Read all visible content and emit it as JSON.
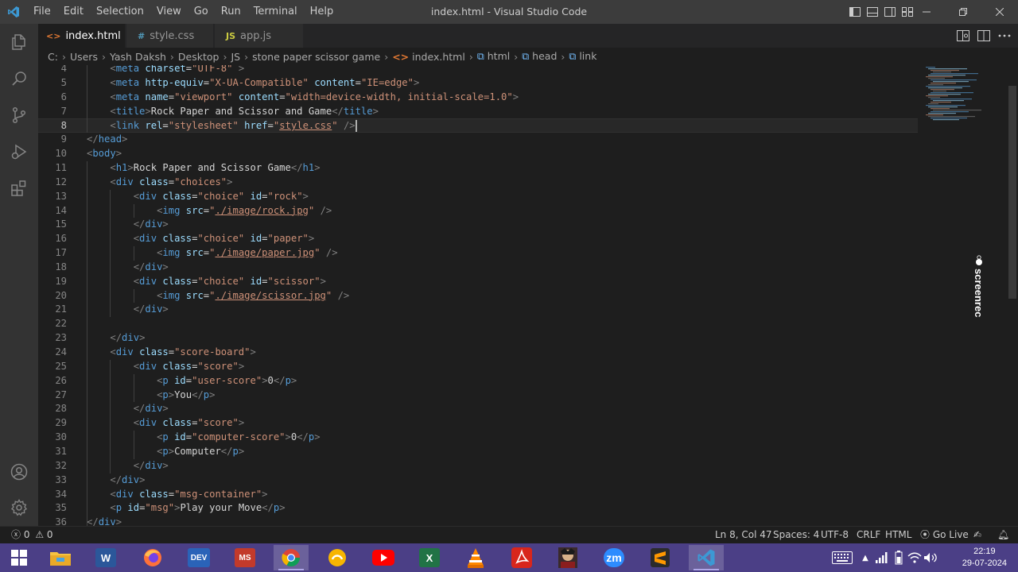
{
  "window": {
    "title": "index.html - Visual Studio Code"
  },
  "menu": [
    "File",
    "Edit",
    "Selection",
    "View",
    "Go",
    "Run",
    "Terminal",
    "Help"
  ],
  "tabs": [
    {
      "label": "index.html",
      "icon": "html-file-icon",
      "icon_glyph": "<>",
      "icon_color": "#e37933",
      "active": true
    },
    {
      "label": "style.css",
      "icon": "css-file-icon",
      "icon_glyph": "#",
      "icon_color": "#519aba",
      "active": false
    },
    {
      "label": "app.js",
      "icon": "js-file-icon",
      "icon_glyph": "JS",
      "icon_color": "#cbcb41",
      "active": false
    }
  ],
  "breadcrumb": [
    "C:",
    "Users",
    "Yash Daksh",
    "Desktop",
    "JS",
    "stone paper scissor game",
    "index.html",
    "html",
    "head",
    "link"
  ],
  "editor": {
    "current_line": 8,
    "lines": [
      {
        "n": "4",
        "indent": 2,
        "segs": [
          [
            "tg",
            "<"
          ],
          [
            "tn",
            "meta"
          ],
          [
            "tx",
            " "
          ],
          [
            "an",
            "charset"
          ],
          [
            "tx",
            "="
          ],
          [
            "av",
            "\"UTF-8\""
          ],
          [
            "tx",
            " "
          ],
          [
            "tg",
            ">"
          ]
        ]
      },
      {
        "n": "5",
        "indent": 2,
        "segs": [
          [
            "tg",
            "<"
          ],
          [
            "tn",
            "meta"
          ],
          [
            "tx",
            " "
          ],
          [
            "an",
            "http-equiv"
          ],
          [
            "tx",
            "="
          ],
          [
            "av",
            "\"X-UA-Compatible\""
          ],
          [
            "tx",
            " "
          ],
          [
            "an",
            "content"
          ],
          [
            "tx",
            "="
          ],
          [
            "av",
            "\"IE=edge\""
          ],
          [
            "tg",
            ">"
          ]
        ]
      },
      {
        "n": "6",
        "indent": 2,
        "segs": [
          [
            "tg",
            "<"
          ],
          [
            "tn",
            "meta"
          ],
          [
            "tx",
            " "
          ],
          [
            "an",
            "name"
          ],
          [
            "tx",
            "="
          ],
          [
            "av",
            "\"viewport\""
          ],
          [
            "tx",
            " "
          ],
          [
            "an",
            "content"
          ],
          [
            "tx",
            "="
          ],
          [
            "av",
            "\"width=device-width, initial-scale=1.0\""
          ],
          [
            "tg",
            ">"
          ]
        ]
      },
      {
        "n": "7",
        "indent": 2,
        "segs": [
          [
            "tg",
            "<"
          ],
          [
            "tn",
            "title"
          ],
          [
            "tg",
            ">"
          ],
          [
            "tx",
            "Rock Paper and Scissor and Game"
          ],
          [
            "tg",
            "</"
          ],
          [
            "tn",
            "title"
          ],
          [
            "tg",
            ">"
          ]
        ]
      },
      {
        "n": "8",
        "indent": 2,
        "segs": [
          [
            "tg",
            "<"
          ],
          [
            "tn",
            "link"
          ],
          [
            "tx",
            " "
          ],
          [
            "an",
            "rel"
          ],
          [
            "tx",
            "="
          ],
          [
            "av",
            "\"stylesheet\""
          ],
          [
            "tx",
            " "
          ],
          [
            "an",
            "href"
          ],
          [
            "tx",
            "="
          ],
          [
            "av",
            "\""
          ],
          [
            "avu",
            "style.css"
          ],
          [
            "av",
            "\""
          ],
          [
            "tx",
            " "
          ],
          [
            "tg",
            "/>"
          ]
        ],
        "cursor": true
      },
      {
        "n": "9",
        "indent": 0,
        "segs": [
          [
            "tg",
            "</"
          ],
          [
            "tn",
            "head"
          ],
          [
            "tg",
            ">"
          ]
        ]
      },
      {
        "n": "10",
        "indent": 0,
        "segs": [
          [
            "tg",
            "<"
          ],
          [
            "tn",
            "body"
          ],
          [
            "tg",
            ">"
          ]
        ]
      },
      {
        "n": "11",
        "indent": 2,
        "segs": [
          [
            "tg",
            "<"
          ],
          [
            "tn",
            "h1"
          ],
          [
            "tg",
            ">"
          ],
          [
            "tx",
            "Rock Paper and Scissor Game"
          ],
          [
            "tg",
            "</"
          ],
          [
            "tn",
            "h1"
          ],
          [
            "tg",
            ">"
          ]
        ]
      },
      {
        "n": "12",
        "indent": 2,
        "segs": [
          [
            "tg",
            "<"
          ],
          [
            "tn",
            "div"
          ],
          [
            "tx",
            " "
          ],
          [
            "an",
            "class"
          ],
          [
            "tx",
            "="
          ],
          [
            "av",
            "\"choices\""
          ],
          [
            "tg",
            ">"
          ]
        ]
      },
      {
        "n": "13",
        "indent": 4,
        "segs": [
          [
            "tg",
            "<"
          ],
          [
            "tn",
            "div"
          ],
          [
            "tx",
            " "
          ],
          [
            "an",
            "class"
          ],
          [
            "tx",
            "="
          ],
          [
            "av",
            "\"choice\""
          ],
          [
            "tx",
            " "
          ],
          [
            "an",
            "id"
          ],
          [
            "tx",
            "="
          ],
          [
            "av",
            "\"rock\""
          ],
          [
            "tg",
            ">"
          ]
        ]
      },
      {
        "n": "14",
        "indent": 6,
        "segs": [
          [
            "tg",
            "<"
          ],
          [
            "tn",
            "img"
          ],
          [
            "tx",
            " "
          ],
          [
            "an",
            "src"
          ],
          [
            "tx",
            "="
          ],
          [
            "av",
            "\""
          ],
          [
            "avu",
            "./image/rock.jpg"
          ],
          [
            "av",
            "\""
          ],
          [
            "tx",
            " "
          ],
          [
            "tg",
            "/>"
          ]
        ]
      },
      {
        "n": "15",
        "indent": 4,
        "segs": [
          [
            "tg",
            "</"
          ],
          [
            "tn",
            "div"
          ],
          [
            "tg",
            ">"
          ]
        ]
      },
      {
        "n": "16",
        "indent": 4,
        "segs": [
          [
            "tg",
            "<"
          ],
          [
            "tn",
            "div"
          ],
          [
            "tx",
            " "
          ],
          [
            "an",
            "class"
          ],
          [
            "tx",
            "="
          ],
          [
            "av",
            "\"choice\""
          ],
          [
            "tx",
            " "
          ],
          [
            "an",
            "id"
          ],
          [
            "tx",
            "="
          ],
          [
            "av",
            "\"paper\""
          ],
          [
            "tg",
            ">"
          ]
        ]
      },
      {
        "n": "17",
        "indent": 6,
        "segs": [
          [
            "tg",
            "<"
          ],
          [
            "tn",
            "img"
          ],
          [
            "tx",
            " "
          ],
          [
            "an",
            "src"
          ],
          [
            "tx",
            "="
          ],
          [
            "av",
            "\""
          ],
          [
            "avu",
            "./image/paper.jpg"
          ],
          [
            "av",
            "\""
          ],
          [
            "tx",
            " "
          ],
          [
            "tg",
            "/>"
          ]
        ]
      },
      {
        "n": "18",
        "indent": 4,
        "segs": [
          [
            "tg",
            "</"
          ],
          [
            "tn",
            "div"
          ],
          [
            "tg",
            ">"
          ]
        ]
      },
      {
        "n": "19",
        "indent": 4,
        "segs": [
          [
            "tg",
            "<"
          ],
          [
            "tn",
            "div"
          ],
          [
            "tx",
            " "
          ],
          [
            "an",
            "class"
          ],
          [
            "tx",
            "="
          ],
          [
            "av",
            "\"choice\""
          ],
          [
            "tx",
            " "
          ],
          [
            "an",
            "id"
          ],
          [
            "tx",
            "="
          ],
          [
            "av",
            "\"scissor\""
          ],
          [
            "tg",
            ">"
          ]
        ]
      },
      {
        "n": "20",
        "indent": 6,
        "segs": [
          [
            "tg",
            "<"
          ],
          [
            "tn",
            "img"
          ],
          [
            "tx",
            " "
          ],
          [
            "an",
            "src"
          ],
          [
            "tx",
            "="
          ],
          [
            "av",
            "\""
          ],
          [
            "avu",
            "./image/scissor.jpg"
          ],
          [
            "av",
            "\""
          ],
          [
            "tx",
            " "
          ],
          [
            "tg",
            "/>"
          ]
        ]
      },
      {
        "n": "21",
        "indent": 4,
        "segs": [
          [
            "tg",
            "</"
          ],
          [
            "tn",
            "div"
          ],
          [
            "tg",
            ">"
          ]
        ]
      },
      {
        "n": "22",
        "indent": 0,
        "segs": []
      },
      {
        "n": "23",
        "indent": 2,
        "segs": [
          [
            "tg",
            "</"
          ],
          [
            "tn",
            "div"
          ],
          [
            "tg",
            ">"
          ]
        ]
      },
      {
        "n": "24",
        "indent": 2,
        "segs": [
          [
            "tg",
            "<"
          ],
          [
            "tn",
            "div"
          ],
          [
            "tx",
            " "
          ],
          [
            "an",
            "class"
          ],
          [
            "tx",
            "="
          ],
          [
            "av",
            "\"score-board\""
          ],
          [
            "tg",
            ">"
          ]
        ]
      },
      {
        "n": "25",
        "indent": 4,
        "segs": [
          [
            "tg",
            "<"
          ],
          [
            "tn",
            "div"
          ],
          [
            "tx",
            " "
          ],
          [
            "an",
            "class"
          ],
          [
            "tx",
            "="
          ],
          [
            "av",
            "\"score\""
          ],
          [
            "tg",
            ">"
          ]
        ]
      },
      {
        "n": "26",
        "indent": 6,
        "segs": [
          [
            "tg",
            "<"
          ],
          [
            "tn",
            "p"
          ],
          [
            "tx",
            " "
          ],
          [
            "an",
            "id"
          ],
          [
            "tx",
            "="
          ],
          [
            "av",
            "\"user-score\""
          ],
          [
            "tg",
            ">"
          ],
          [
            "tx",
            "0"
          ],
          [
            "tg",
            "</"
          ],
          [
            "tn",
            "p"
          ],
          [
            "tg",
            ">"
          ]
        ]
      },
      {
        "n": "27",
        "indent": 6,
        "segs": [
          [
            "tg",
            "<"
          ],
          [
            "tn",
            "p"
          ],
          [
            "tg",
            ">"
          ],
          [
            "tx",
            "You"
          ],
          [
            "tg",
            "</"
          ],
          [
            "tn",
            "p"
          ],
          [
            "tg",
            ">"
          ]
        ]
      },
      {
        "n": "28",
        "indent": 4,
        "segs": [
          [
            "tg",
            "</"
          ],
          [
            "tn",
            "div"
          ],
          [
            "tg",
            ">"
          ]
        ]
      },
      {
        "n": "29",
        "indent": 4,
        "segs": [
          [
            "tg",
            "<"
          ],
          [
            "tn",
            "div"
          ],
          [
            "tx",
            " "
          ],
          [
            "an",
            "class"
          ],
          [
            "tx",
            "="
          ],
          [
            "av",
            "\"score\""
          ],
          [
            "tg",
            ">"
          ]
        ]
      },
      {
        "n": "30",
        "indent": 6,
        "segs": [
          [
            "tg",
            "<"
          ],
          [
            "tn",
            "p"
          ],
          [
            "tx",
            " "
          ],
          [
            "an",
            "id"
          ],
          [
            "tx",
            "="
          ],
          [
            "av",
            "\"computer-score\""
          ],
          [
            "tg",
            ">"
          ],
          [
            "tx",
            "0"
          ],
          [
            "tg",
            "</"
          ],
          [
            "tn",
            "p"
          ],
          [
            "tg",
            ">"
          ]
        ]
      },
      {
        "n": "31",
        "indent": 6,
        "segs": [
          [
            "tg",
            "<"
          ],
          [
            "tn",
            "p"
          ],
          [
            "tg",
            ">"
          ],
          [
            "tx",
            "Computer"
          ],
          [
            "tg",
            "</"
          ],
          [
            "tn",
            "p"
          ],
          [
            "tg",
            ">"
          ]
        ]
      },
      {
        "n": "32",
        "indent": 4,
        "segs": [
          [
            "tg",
            "</"
          ],
          [
            "tn",
            "div"
          ],
          [
            "tg",
            ">"
          ]
        ]
      },
      {
        "n": "33",
        "indent": 2,
        "segs": [
          [
            "tg",
            "</"
          ],
          [
            "tn",
            "div"
          ],
          [
            "tg",
            ">"
          ]
        ]
      },
      {
        "n": "34",
        "indent": 2,
        "segs": [
          [
            "tg",
            "<"
          ],
          [
            "tn",
            "div"
          ],
          [
            "tx",
            " "
          ],
          [
            "an",
            "class"
          ],
          [
            "tx",
            "="
          ],
          [
            "av",
            "\"msg-container\""
          ],
          [
            "tg",
            ">"
          ]
        ]
      },
      {
        "n": "35",
        "indent": 2,
        "segs": [
          [
            "tg",
            "<"
          ],
          [
            "tn",
            "p"
          ],
          [
            "tx",
            " "
          ],
          [
            "an",
            "id"
          ],
          [
            "tx",
            "="
          ],
          [
            "av",
            "\"msg\""
          ],
          [
            "tg",
            ">"
          ],
          [
            "tx",
            "Play your Move"
          ],
          [
            "tg",
            "</"
          ],
          [
            "tn",
            "p"
          ],
          [
            "tg",
            ">"
          ]
        ]
      },
      {
        "n": "36",
        "indent": 0,
        "segs": [
          [
            "tg",
            "</"
          ],
          [
            "tn",
            "div"
          ],
          [
            "tg",
            ">"
          ]
        ]
      }
    ]
  },
  "watermark": {
    "text": "screenrec"
  },
  "statusbar": {
    "errors": "0",
    "warnings": "0",
    "position": "Ln 8, Col 47",
    "spaces": "Spaces: 4",
    "encoding": "UTF-8",
    "eol": "CRLF",
    "language": "HTML",
    "golive": "Go Live"
  },
  "taskbar": {
    "apps": [
      {
        "name": "windows-start",
        "label": ""
      },
      {
        "name": "file-explorer",
        "label": ""
      },
      {
        "name": "word",
        "label": "W"
      },
      {
        "name": "firefox",
        "label": ""
      },
      {
        "name": "dev-cpp",
        "label": "DEV"
      },
      {
        "name": "ms-project",
        "label": "MS"
      },
      {
        "name": "chrome",
        "label": ""
      },
      {
        "name": "app-yellow",
        "label": ""
      },
      {
        "name": "youtube",
        "label": ""
      },
      {
        "name": "excel",
        "label": "X"
      },
      {
        "name": "vlc",
        "label": ""
      },
      {
        "name": "acrobat",
        "label": ""
      },
      {
        "name": "tekken",
        "label": ""
      },
      {
        "name": "zoom",
        "label": "zm"
      },
      {
        "name": "sublime",
        "label": ""
      },
      {
        "name": "vscode",
        "label": ""
      }
    ],
    "time": "22:19",
    "date": "29-07-2024"
  },
  "colors": {
    "titlebar": "#3c3c3c",
    "activitybar": "#333333",
    "editor_bg": "#1e1e1e",
    "taskbar": "#4b3f86",
    "accent": "#007acc"
  }
}
